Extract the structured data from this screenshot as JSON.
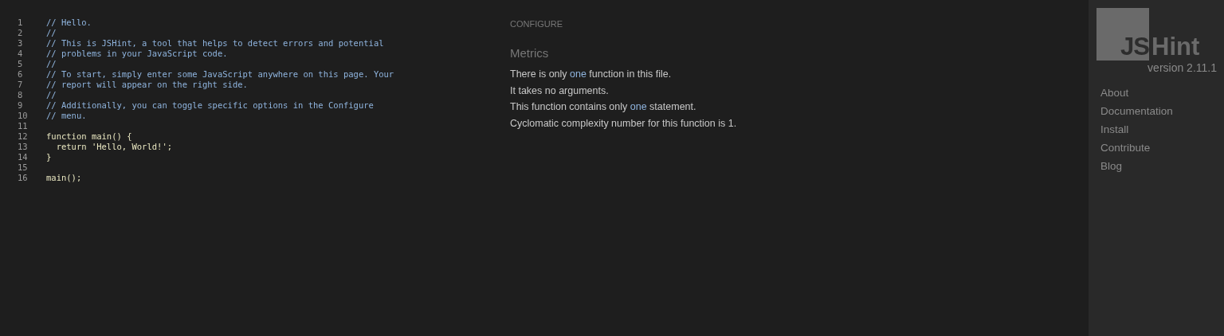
{
  "editor": {
    "lines": [
      {
        "number": "1",
        "kind": "comment",
        "text": "// Hello."
      },
      {
        "number": "2",
        "kind": "comment",
        "text": "//"
      },
      {
        "number": "3",
        "kind": "comment",
        "text": "// This is JSHint, a tool that helps to detect errors and potential"
      },
      {
        "number": "4",
        "kind": "comment",
        "text": "// problems in your JavaScript code."
      },
      {
        "number": "5",
        "kind": "comment",
        "text": "//"
      },
      {
        "number": "6",
        "kind": "comment",
        "text": "// To start, simply enter some JavaScript anywhere on this page. Your"
      },
      {
        "number": "7",
        "kind": "comment",
        "text": "// report will appear on the right side."
      },
      {
        "number": "8",
        "kind": "comment",
        "text": "//"
      },
      {
        "number": "9",
        "kind": "comment",
        "text": "// Additionally, you can toggle specific options in the Configure"
      },
      {
        "number": "10",
        "kind": "comment",
        "text": "// menu."
      },
      {
        "number": "11",
        "kind": "blank"
      },
      {
        "number": "12",
        "kind": "code",
        "text": "function main() {"
      },
      {
        "number": "13",
        "kind": "code",
        "text": "  return 'Hello, World!';"
      },
      {
        "number": "14",
        "kind": "code",
        "text": "}"
      },
      {
        "number": "15",
        "kind": "blank"
      },
      {
        "number": "16",
        "kind": "code",
        "text": "main();"
      }
    ]
  },
  "report": {
    "configure": "CONFIGURE",
    "heading": "Metrics",
    "sentences": [
      {
        "parts": [
          {
            "text": "There is only ",
            "highlight": false
          },
          {
            "text": "one",
            "highlight": true
          },
          {
            "text": " function in this file.",
            "highlight": false
          }
        ]
      },
      {
        "parts": [
          {
            "text": "It takes no arguments.",
            "highlight": false
          }
        ]
      },
      {
        "parts": [
          {
            "text": "This function contains only ",
            "highlight": false
          },
          {
            "text": "one",
            "highlight": true
          },
          {
            "text": " statement.",
            "highlight": false
          }
        ]
      },
      {
        "parts": [
          {
            "text": "Cyclomatic complexity number for this function is 1.",
            "highlight": false
          }
        ]
      }
    ]
  },
  "sidebar": {
    "logo": {
      "left": "JS",
      "right": "Hint"
    },
    "version": "version 2.11.1",
    "links": [
      "About",
      "Documentation",
      "Install",
      "Contribute",
      "Blog"
    ]
  }
}
